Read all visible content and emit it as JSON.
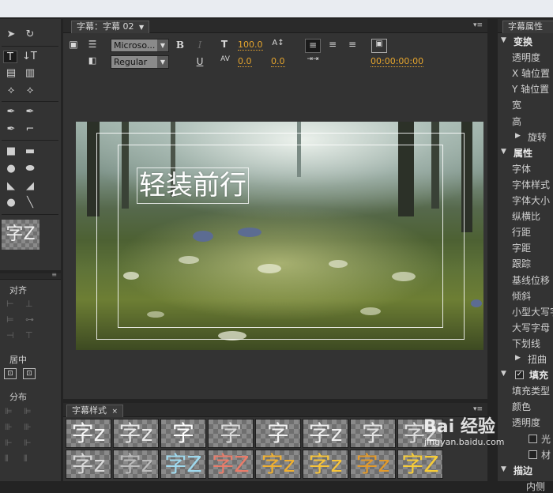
{
  "titler_panel": {
    "tab_label": "字幕：字幕 02",
    "font_family": "Microso...",
    "font_style": "Regular",
    "bold": "B",
    "italic": "I",
    "underline": "U",
    "font_size": "100.0",
    "kerning": "0.0",
    "leading": "0.0",
    "timecode": "00:00:00:00"
  },
  "canvas": {
    "title_text": "轻装前行"
  },
  "tools": {
    "style_preview": "字Z",
    "align_label": "对齐",
    "center_label": "居中",
    "distribute_label": "分布"
  },
  "styles_panel": {
    "tab_label": "字幕样式",
    "row1": [
      "字z",
      "字z",
      "字",
      "字",
      "字",
      "字z",
      "字",
      "字z"
    ],
    "row2": [
      "字z",
      "字z",
      "字Z",
      "字Z",
      "字z",
      "字z",
      "字z",
      "字Z"
    ]
  },
  "properties_panel": {
    "tab_label": "字幕属性",
    "items": [
      {
        "label": "变换",
        "head": true
      },
      {
        "label": "透明度"
      },
      {
        "label": "X 轴位置"
      },
      {
        "label": "Y 轴位置"
      },
      {
        "label": "宽"
      },
      {
        "label": "高"
      },
      {
        "label": "旋转"
      },
      {
        "label": "属性",
        "head": true
      },
      {
        "label": "字体"
      },
      {
        "label": "字体样式"
      },
      {
        "label": "字体大小"
      },
      {
        "label": "纵横比"
      },
      {
        "label": "行距"
      },
      {
        "label": "字距"
      },
      {
        "label": "跟踪"
      },
      {
        "label": "基线位移"
      },
      {
        "label": "倾斜"
      },
      {
        "label": "小型大写字"
      },
      {
        "label": "大写字母"
      },
      {
        "label": "下划线"
      },
      {
        "label": "扭曲"
      },
      {
        "label": "填充",
        "head": true
      },
      {
        "label": "填充类型"
      },
      {
        "label": "颜色"
      },
      {
        "label": "透明度"
      },
      {
        "label": "光"
      },
      {
        "label": "材"
      },
      {
        "label": "描边",
        "head": true
      },
      {
        "label": "内侧"
      }
    ]
  },
  "watermark": {
    "brand": "Bai 经验",
    "url": "jingyan.baidu.com"
  },
  "colors": {
    "accent_value": "#e6a52d",
    "panel_bg": "#333333",
    "app_bg": "#232323"
  }
}
